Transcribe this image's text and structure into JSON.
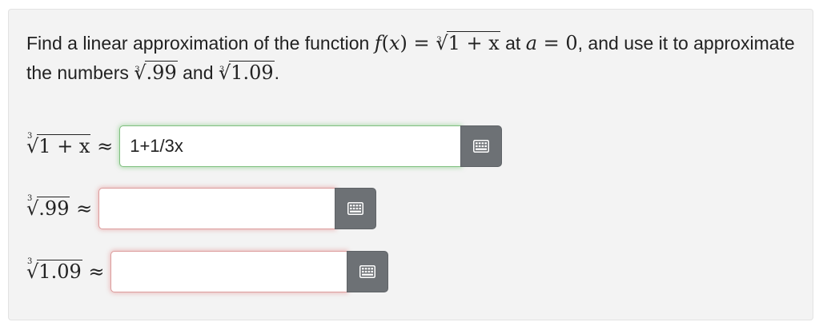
{
  "problem": {
    "text_1": "Find a linear approximation of the function",
    "f_name": "f",
    "f_arg": "(x)",
    "eq": " = ",
    "root_index": "3",
    "root_expr": "1 + x",
    "text_2": "at",
    "a_var": "a",
    "a_eq": " = 0",
    "text_3": ", and use it to approximate the numbers",
    "num1": ".99",
    "text_and": "and",
    "num2": "1.09",
    "period": "."
  },
  "rows": [
    {
      "radicand": "1 + x",
      "approx": "≈",
      "value": "1+1/3x",
      "state": "correct",
      "keyboard_icon": "keyboard-icon"
    },
    {
      "radicand": ".99",
      "approx": "≈",
      "value": "",
      "state": "incorrect",
      "keyboard_icon": "keyboard-icon"
    },
    {
      "radicand": "1.09",
      "approx": "≈",
      "value": "",
      "state": "incorrect",
      "keyboard_icon": "keyboard-icon"
    }
  ],
  "colors": {
    "correct_glow": "#7fbf7f",
    "incorrect_glow": "#dc9c9c",
    "keyboard_button": "#6d7175",
    "panel_background": "#f3f3f3"
  }
}
